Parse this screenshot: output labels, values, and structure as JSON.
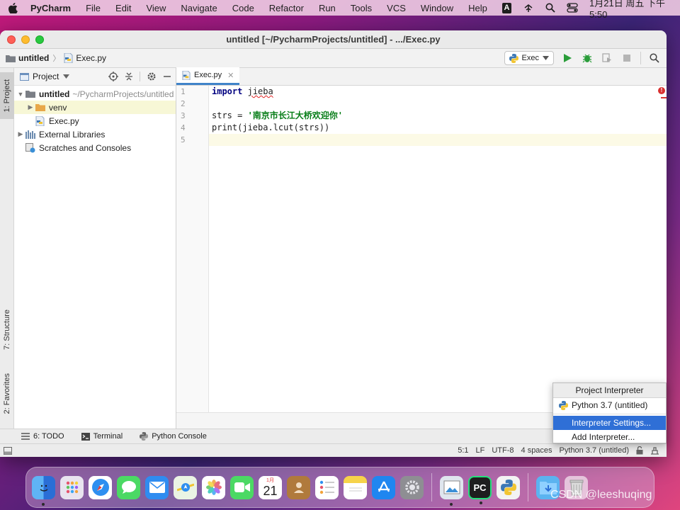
{
  "menubar": {
    "app_name": "PyCharm",
    "items": [
      "File",
      "Edit",
      "View",
      "Navigate",
      "Code",
      "Refactor",
      "Run",
      "Tools",
      "VCS",
      "Window",
      "Help"
    ],
    "input_indicator": "A",
    "clock": "1月21日 周五 下午5:50"
  },
  "window": {
    "title": "untitled [~/PycharmProjects/untitled] - .../Exec.py"
  },
  "navbar": {
    "breadcrumb_root": "untitled",
    "breadcrumb_file": "Exec.py",
    "run_config": "Exec"
  },
  "left_stripe": {
    "project_tab": "1: Project",
    "structure_tab": "7: Structure",
    "favorites_tab": "2: Favorites"
  },
  "project_panel": {
    "title": "Project",
    "tree": {
      "root_name": "untitled",
      "root_path": "~/PycharmProjects/untitled",
      "venv": "venv",
      "file": "Exec.py",
      "external_libs": "External Libraries",
      "scratches": "Scratches and Consoles"
    }
  },
  "editor": {
    "tab_label": "Exec.py",
    "line_numbers": [
      "1",
      "2",
      "3",
      "4",
      "5"
    ],
    "lines": {
      "l1_kw": "import",
      "l1_rest": "jieba",
      "l3_var": "strs = ",
      "l3_str": "'南京市长江大桥欢迎你'",
      "l4": "print(jieba.lcut(strs))"
    }
  },
  "bottom_tools": {
    "todo": "6: TODO",
    "terminal": "Terminal",
    "python_console": "Python Console"
  },
  "statusbar": {
    "position": "5:1",
    "line_sep": "LF",
    "encoding": "UTF-8",
    "indent": "4 spaces",
    "interpreter": "Python 3.7 (untitled)"
  },
  "interpreter_popup": {
    "header": "Project Interpreter",
    "current": "Python 3.7 (untitled)",
    "settings": "Interpreter Settings...",
    "add": "Add Interpreter..."
  },
  "dock": {
    "calendar_month": "1月",
    "calendar_day": "21"
  },
  "watermark": "CSDN @leeshuqing",
  "colors": {
    "accent_blue": "#2f6fd6",
    "keyword": "#000080",
    "string": "#067d17",
    "run_green": "#2a9d3a"
  }
}
